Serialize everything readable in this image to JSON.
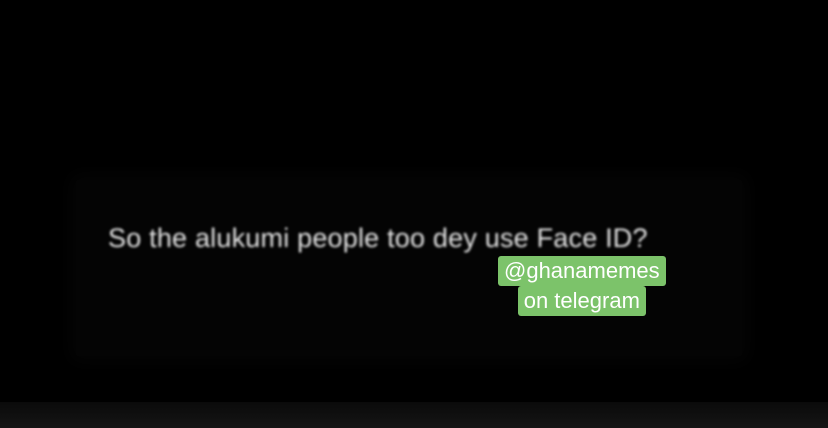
{
  "caption": {
    "text": "So the alukumi people too dey use Face ID?"
  },
  "watermark": {
    "line1": "@ghanamemes",
    "line2": "on telegram",
    "background_color": "#7cc36a",
    "text_color": "#ffffff"
  },
  "colors": {
    "background": "#000000",
    "caption_text": "#e6e6e6"
  }
}
